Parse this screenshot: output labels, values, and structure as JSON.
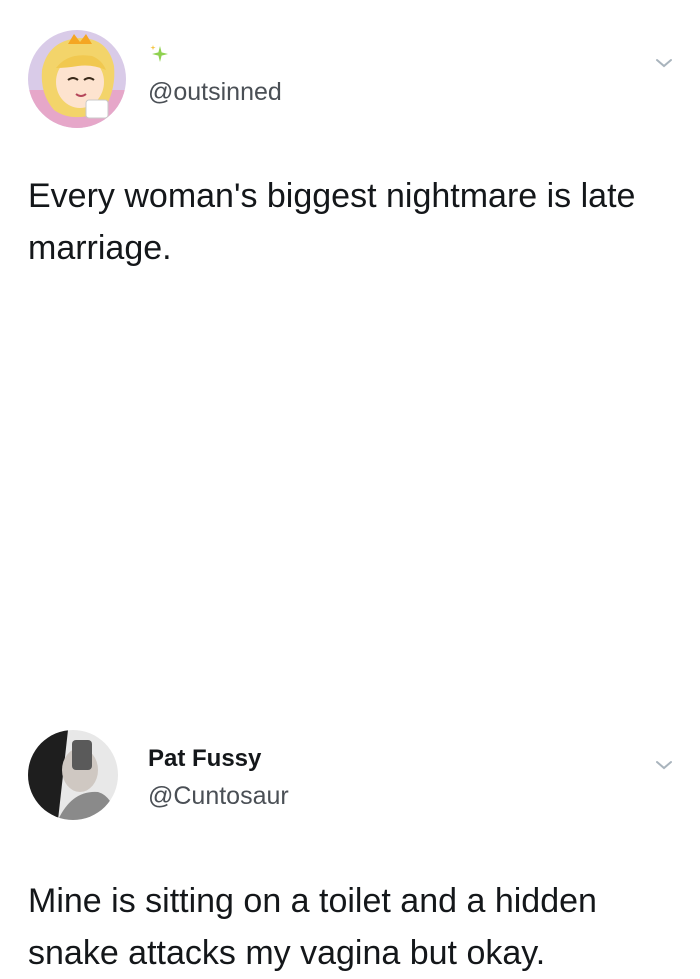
{
  "tweets": [
    {
      "display_name": "",
      "handle": "@outsinned",
      "name_icon": "sparkle-icon",
      "text": "Every woman's biggest nightmare is late marriage.",
      "avatar": "cartoon-princess-avatar",
      "menu_icon": "chevron-down-icon"
    },
    {
      "display_name": "Pat Fussy",
      "handle": "@Cuntosaur",
      "text": "Mine is sitting on a toilet and a hidden snake attacks my vagina but okay.",
      "avatar": "selfie-avatar",
      "menu_icon": "chevron-down-icon"
    }
  ],
  "colors": {
    "text": "#14171a",
    "handle": "#4a4f55",
    "chevron": "#a9b4bd",
    "sparkle": "#8fd14f"
  }
}
